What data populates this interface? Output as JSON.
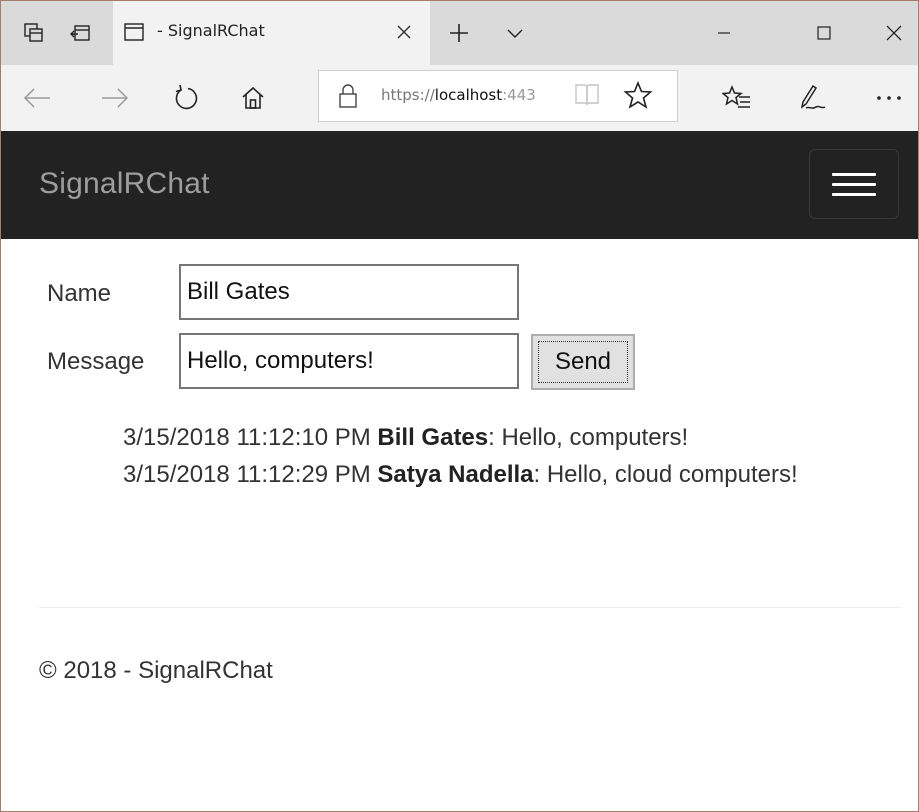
{
  "browser": {
    "tab_title": "- SignalRChat",
    "url_prefix": "https://",
    "url_host": "localhost",
    "url_rest": ":443"
  },
  "site": {
    "brand": "SignalRChat",
    "menu_icon": "hamburger-menu-icon"
  },
  "form": {
    "name_label": "Name",
    "name_value": "Bill Gates",
    "message_label": "Message",
    "message_value": "Hello, computers!",
    "send_label": "Send"
  },
  "messages": [
    {
      "timestamp": "3/15/2018 11:12:10 PM",
      "user": "Bill Gates",
      "text": ": Hello, computers!"
    },
    {
      "timestamp": "3/15/2018 11:12:29 PM",
      "user": "Satya Nadella",
      "text": ": Hello, cloud computers!"
    }
  ],
  "footer": {
    "text": "© 2018 - SignalRChat"
  },
  "colors": {
    "header_bg": "#222222",
    "brand_text": "#9d9d9d",
    "tabbar_bg": "#dadada",
    "toolbar_bg": "#f2f2f2",
    "window_border": "#a47c6c"
  }
}
